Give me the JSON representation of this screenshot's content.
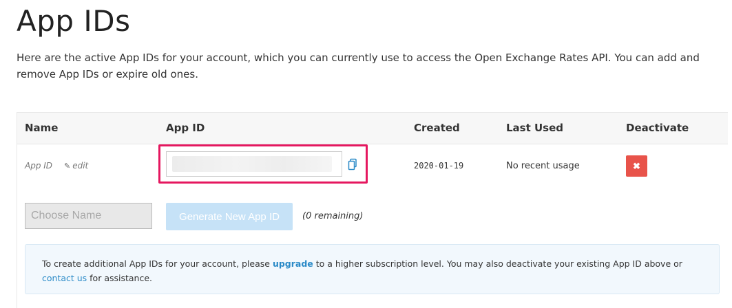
{
  "page": {
    "title": "App IDs",
    "intro": "Here are the active App IDs for your account, which you can currently use to access the Open Exchange Rates API. You can add and remove App IDs or expire old ones."
  },
  "table": {
    "headers": {
      "name": "Name",
      "app_id": "App ID",
      "created": "Created",
      "last_used": "Last Used",
      "deactivate": "Deactivate"
    },
    "rows": [
      {
        "name": "App ID",
        "edit_label": "edit",
        "app_id_value": "",
        "created": "2020-01-19",
        "last_used": "No recent usage",
        "deactivate_icon": "close-icon"
      }
    ]
  },
  "new_app": {
    "name_placeholder": "Choose Name",
    "generate_label": "Generate New App ID",
    "remaining": "(0 remaining)"
  },
  "info": {
    "text_1": "To create additional App IDs for your account, please ",
    "upgrade_link": "upgrade",
    "text_2": " to a higher subscription level. You may also deactivate your existing App ID above or ",
    "contact_link": "contact us",
    "text_3": " for assistance."
  },
  "colors": {
    "highlight": "#e5175f",
    "deactivate": "#e8534a",
    "link": "#2a8ac7",
    "generate_disabled": "#c6e2f7"
  }
}
